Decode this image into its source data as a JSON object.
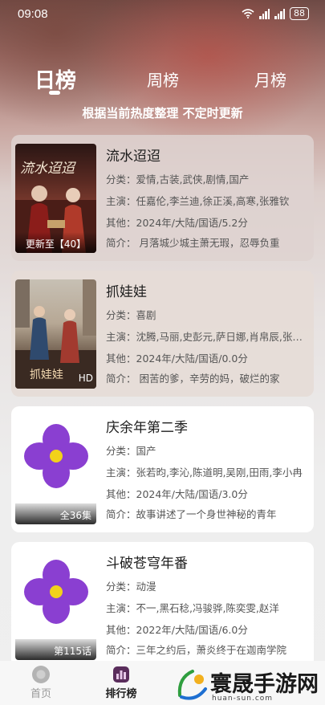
{
  "status_bar": {
    "time": "09:08",
    "battery": "88"
  },
  "tabs": [
    {
      "label": "日榜"
    },
    {
      "label": "周榜"
    },
    {
      "label": "月榜"
    }
  ],
  "subtitle": "根据当前热度整理 不定时更新",
  "list": [
    {
      "title": "流水迢迢",
      "category": "分类：爱情,古装,武侠,剧情,国产",
      "cast": "主演：任嘉伦,李兰迪,徐正溪,高寒,张雅钦",
      "other": "其他：2024年/大陆/国语/5.2分",
      "intro": "简介：        月落城少城主萧无瑕，忍辱负重",
      "poster_text": "流水迢迢",
      "badge": "更新至【40】"
    },
    {
      "title": "抓娃娃",
      "category": "分类：喜剧",
      "cast": "主演：沈腾,马丽,史彭元,萨日娜,肖帛辰,张子贤",
      "other": "其他：2024年/大陆/国语/0.0分",
      "intro": "简介：        困苦的爹，辛劳的妈，破烂的家",
      "poster_text": "抓娃娃",
      "badge": "HD"
    },
    {
      "title": "庆余年第二季",
      "category": "分类：国产",
      "cast": "主演：张若昀,李沁,陈道明,吴刚,田雨,李小冉",
      "other": "其他：2024年/大陆/国语/3.0分",
      "intro": "简介：故事讲述了一个身世神秘的青年",
      "badge": "全36集"
    },
    {
      "title": "斗破苍穹年番",
      "category": "分类：动漫",
      "cast": "主演：不一,黑石稔,冯骏骅,陈奕雯,赵洋",
      "other": "其他：2022年/大陆/国语/6.0分",
      "intro": "简介：三年之约后，萧炎终于在迦南学院",
      "badge": "第115话"
    }
  ],
  "bottom_nav": [
    {
      "label": "首页"
    },
    {
      "label": "排行榜"
    }
  ],
  "watermark": {
    "title": "寰晟手游网",
    "url": "huan-sun.com"
  },
  "colors": {
    "flower": "#8a3fd1",
    "flower_center": "#f2d21a"
  }
}
